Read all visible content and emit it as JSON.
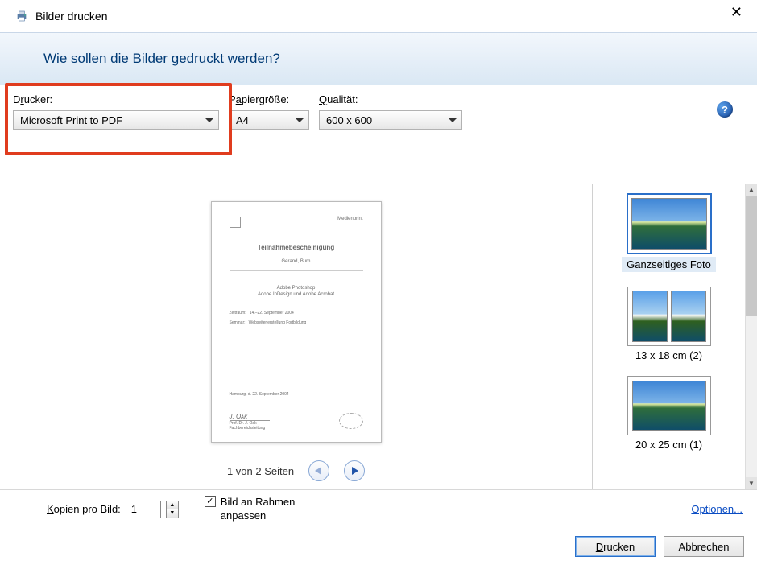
{
  "window": {
    "title": "Bilder drucken",
    "close_glyph": "✕"
  },
  "header": {
    "question": "Wie sollen die Bilder gedruckt werden?"
  },
  "fields": {
    "printer": {
      "label_pre": "D",
      "label_ul": "r",
      "label_post": "ucker:",
      "value": "Microsoft Print to PDF"
    },
    "paper": {
      "label_pre": "P",
      "label_ul": "a",
      "label_post": "piergröße:",
      "value": "A4"
    },
    "quality": {
      "label_pre": "",
      "label_ul": "Q",
      "label_post": "ualität:",
      "value": "600 x 600"
    }
  },
  "help_glyph": "?",
  "preview": {
    "doc_title": "Teilnahmebescheinigung",
    "doc_name": "Gerand, Burn",
    "doc_line1": "Adobe Photoshop",
    "doc_line2": "Adobe InDesign und Adobe Acrobat",
    "pager_text": "1 von 2 Seiten"
  },
  "layouts": {
    "items": [
      {
        "label": "Ganzseitiges Foto"
      },
      {
        "label": "13 x 18 cm (2)"
      },
      {
        "label": "20 x 25 cm (1)"
      }
    ]
  },
  "bottom": {
    "copies_label_pre": "",
    "copies_label_ul": "K",
    "copies_label_post": "opien pro Bild:",
    "copies_value": "1",
    "fit_label": "Bild an Rahmen anpassen",
    "check_glyph": "✓",
    "options_link": "Optionen..."
  },
  "buttons": {
    "print_pre": "",
    "print_ul": "D",
    "print_post": "rucken",
    "cancel": "Abbrechen"
  },
  "scroll": {
    "up": "▲",
    "down": "▼"
  }
}
